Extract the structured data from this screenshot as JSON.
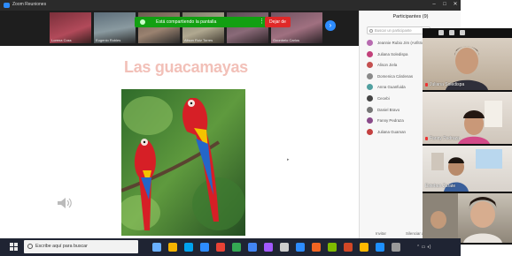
{
  "window": {
    "title": "Zoom Reuniones"
  },
  "thumbstrip": {
    "names": [
      "Lorena Coss",
      "Eugenio Robles",
      "",
      "Alison Ruiz Torres",
      "",
      "Goonbelo Carlos"
    ]
  },
  "share_bar": {
    "label": "Está compartiendo la pantalla",
    "stop_label": "Dejar de"
  },
  "slide": {
    "title": "Las guacamayas"
  },
  "participants": {
    "header": "Participantes (9)",
    "search_placeholder": "Buscar un participante",
    "list": [
      {
        "name": "Jeannie Rubio Jim (Anfitrión, yo)",
        "color": "#b76bb0"
      },
      {
        "name": "Juliana Soledispa",
        "color": "#c2407a"
      },
      {
        "name": "Alison Jiela",
        "color": "#c45050"
      },
      {
        "name": "Domenica Cárdenas",
        "color": "#8a8a8a"
      },
      {
        "name": "Anna Guanfuida",
        "color": "#50a0a0"
      },
      {
        "name": "Cecebi",
        "color": "#444444"
      },
      {
        "name": "Daniel Bravo",
        "color": "#777777"
      },
      {
        "name": "Fanny Pedraza",
        "color": "#8a4b8a"
      },
      {
        "name": "Juliana Guaman",
        "color": "#c44040"
      }
    ],
    "invite_label": "Invitar",
    "mute_label": "Silenciar a todos"
  },
  "gallery": {
    "tiles": [
      {
        "label": "Juliana Soledispa"
      },
      {
        "label": "Fanny Pedraza"
      },
      {
        "label": "Esteban Zarate"
      },
      {
        "label": ""
      }
    ]
  },
  "taskbar": {
    "search_placeholder": "Escribe aquí para buscar",
    "icon_colors": [
      "#6ab0ff",
      "#f4b400",
      "#00a2ed",
      "#2d8cff",
      "#e94235",
      "#34a853",
      "#4285f4",
      "#a259ff",
      "#cccccc",
      "#2d8cff",
      "#f26522",
      "#7fba00",
      "#d24726",
      "#ffb900",
      "#1e90ff",
      "#9a9a9a"
    ]
  }
}
